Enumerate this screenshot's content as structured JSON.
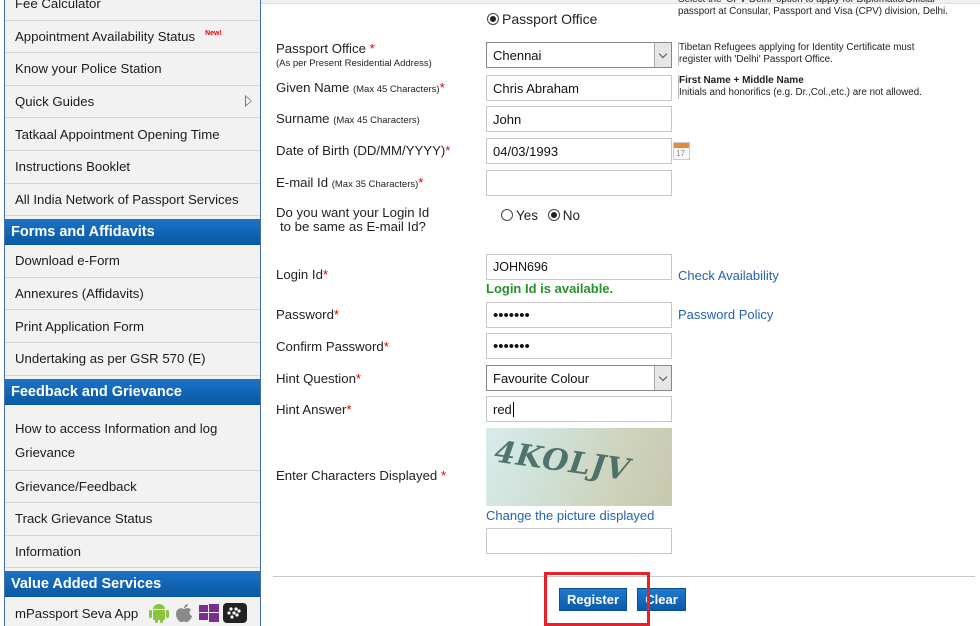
{
  "sidebar": {
    "group1": [
      {
        "label": "Fee Calculator"
      },
      {
        "label": "Appointment Availability Status",
        "badge": "New!"
      },
      {
        "label": "Know your Police Station"
      },
      {
        "label": "Quick Guides"
      },
      {
        "label": "Tatkaal Appointment Opening Time"
      },
      {
        "label": "Instructions Booklet"
      },
      {
        "label": "All India Network of Passport Services"
      }
    ],
    "forms_heading": "Forms and Affidavits",
    "forms": [
      {
        "label": "Download e-Form"
      },
      {
        "label": "Annexures (Affidavits)"
      },
      {
        "label": "Print Application Form"
      },
      {
        "label": "Undertaking as per GSR 570 (E)"
      }
    ],
    "feedback_heading": "Feedback and Grievance",
    "feedback": [
      {
        "label_line1": "How to access Information and log",
        "label_line2": "Grievance"
      },
      {
        "label": "Grievance/Feedback"
      },
      {
        "label": "Track Grievance Status"
      },
      {
        "label": "Information"
      }
    ],
    "vas_heading": "Value Added Services",
    "vas": [
      {
        "label": "mPassport Seva App",
        "icons": [
          "android-icon",
          "apple-icon",
          "windows-icon",
          "blackberry-icon"
        ]
      }
    ]
  },
  "form": {
    "office_radio_label": "Passport Office",
    "passport_office": {
      "label": "Passport Office",
      "sub": "(As per Present Residential Address)",
      "value": "Chennai"
    },
    "given_name": {
      "label": "Given Name",
      "hint": "(Max 45 Characters)",
      "value": "Chris Abraham"
    },
    "surname": {
      "label": "Surname",
      "hint": "(Max 45 Characters)",
      "value": "John"
    },
    "dob": {
      "label": "Date of Birth (DD/MM/YYYY)",
      "value": "04/03/1993",
      "calendar_day": "17"
    },
    "email": {
      "label": "E-mail Id",
      "hint": "(Max 35 Characters)",
      "value": ""
    },
    "login_same": {
      "label_line1": "Do you want your Login Id",
      "label_line2": "to be same as E-mail Id?",
      "yes": "Yes",
      "no": "No",
      "selected": "No"
    },
    "login_id": {
      "label": "Login Id",
      "value": "JOHN696",
      "status": "Login Id is available.",
      "check_link": "Check Availability"
    },
    "password": {
      "label": "Password",
      "value": "•••••••",
      "policy_link": "Password Policy"
    },
    "confirm_password": {
      "label": "Confirm Password",
      "value": "•••••••"
    },
    "hint_question": {
      "label": "Hint Question",
      "value": "Favourite Colour"
    },
    "hint_answer": {
      "label": "Hint Answer",
      "value": "red"
    },
    "captcha": {
      "label": "Enter Characters Displayed",
      "text": "4KOLJV",
      "change_link": "Change the picture displayed",
      "value": ""
    },
    "required_mark": "*"
  },
  "help": {
    "cpv_line1": "Select the 'CPV Delhi' option to apply for Diplomatic/Official",
    "cpv_line2": "passport at Consular, Passport and Visa (CPV) division, Delhi.",
    "tibetan_line1": "Tibetan Refugees applying for Identity Certificate must",
    "tibetan_line2": "register with 'Delhi' Passport Office.",
    "name_title": "First Name + Middle Name",
    "name_text": "Initials and honorifics (e.g. Dr.,Col.,etc.) are not allowed."
  },
  "buttons": {
    "register": "Register",
    "clear": "Clear"
  }
}
